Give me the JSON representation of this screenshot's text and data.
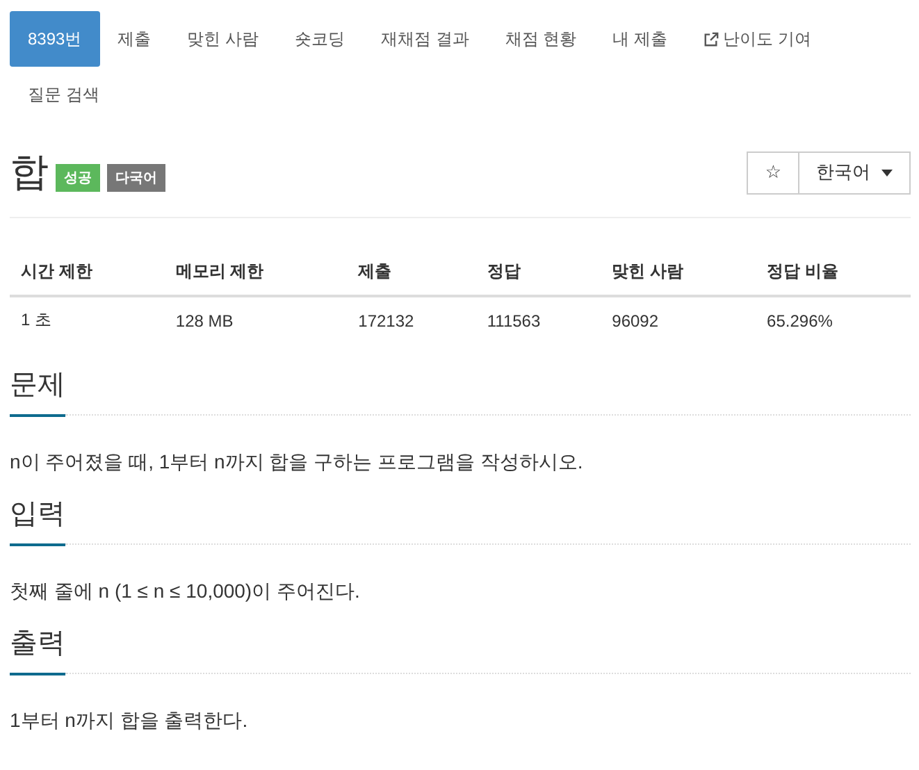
{
  "tabs": [
    {
      "label": "8393번",
      "selected": true,
      "kind": "plain"
    },
    {
      "label": "제출",
      "selected": false,
      "kind": "plain"
    },
    {
      "label": "맞힌 사람",
      "selected": false,
      "kind": "plain"
    },
    {
      "label": "숏코딩",
      "selected": false,
      "kind": "plain"
    },
    {
      "label": "재채점 결과",
      "selected": false,
      "kind": "plain"
    },
    {
      "label": "채점 현황",
      "selected": false,
      "kind": "plain"
    },
    {
      "label": "내 제출",
      "selected": false,
      "kind": "plain"
    },
    {
      "label": "난이도 기여",
      "selected": false,
      "kind": "external"
    },
    {
      "label": "질문 검색",
      "selected": false,
      "kind": "plain"
    }
  ],
  "problem": {
    "title": "합",
    "badges": [
      {
        "label": "성공",
        "color": "#5cb85c"
      },
      {
        "label": "다국어",
        "color": "#777777"
      }
    ],
    "favorite_button": "☆",
    "language_button": "한국어"
  },
  "table": {
    "columns": [
      "시간 제한",
      "메모리 제한",
      "제출",
      "정답",
      "맞힌 사람",
      "정답 비율"
    ],
    "rows": [
      [
        "1 초",
        "128 MB",
        "172132",
        "111563",
        "96092",
        "65.296%"
      ]
    ]
  },
  "sections": [
    {
      "heading": "문제",
      "body": "n이 주어졌을 때, 1부터 n까지 합을 구하는 프로그램을 작성하시오."
    },
    {
      "heading": "입력",
      "body": "첫째 줄에 n (1 ≤ n ≤ 10,000)이 주어진다."
    },
    {
      "heading": "출력",
      "body": "1부터 n까지 합을 출력한다."
    }
  ]
}
